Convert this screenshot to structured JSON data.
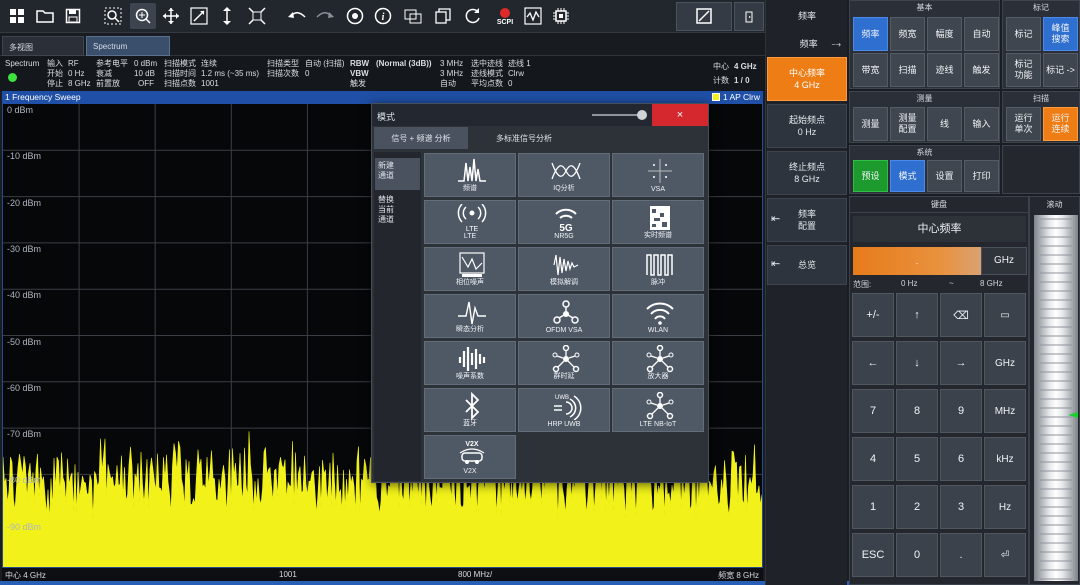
{
  "toolbar": {
    "icons": [
      "windows-icon",
      "open-folder-icon",
      "save-icon",
      "zoom-area-icon",
      "zoom-icon",
      "move-icon",
      "resize-icon",
      "vertical-arrow-icon",
      "fit-icon",
      "undo-icon",
      "redo-icon",
      "capture-icon",
      "info-icon",
      "screenshot-icon",
      "copy-icon",
      "refresh-icon",
      "scpi-icon",
      "waveform-icon",
      "chip-icon"
    ],
    "scpi_label": "SCPI"
  },
  "tabs": [
    "多视图",
    "Spectrum"
  ],
  "info": {
    "spectrum": "Spectrum",
    "input_label": "输入",
    "input_value": "RF",
    "start_label": "开始",
    "start_value": "0 Hz",
    "stop_label": "停止",
    "stop_value": "8 GHz",
    "ref_label": "参考电平",
    "ref_value": "0 dBm",
    "att_label": "衰减",
    "att_value": "10 dB",
    "preamp_label": "前置放",
    "preamp_value": "OFF",
    "sweepmode_label": "扫描模式",
    "sweepmode_value": "连续",
    "sweeptime_label": "扫描时间",
    "sweeptime_value": "1.2 ms (~35 ms)",
    "points_label": "扫描点数",
    "points_value": "1001",
    "sweeptype_label": "扫描类型",
    "sweeptype_value": "自动 (扫描)",
    "count_label": "扫描次数",
    "count_value": "0",
    "rbw_label": "RBW",
    "rbw_mode": "(Normal (3dB))",
    "rbw_value": "3 MHz",
    "vbw_label": "VBW",
    "vbw_value": "3 MHz",
    "trigger_label": "触发",
    "trigger_value": "自动",
    "sel_trace_label": "选中迹线",
    "sel_trace_value": "迹线 1",
    "trace_mode_label": "迹线模式",
    "trace_mode_value": "Clrw",
    "avg_label": "平均点数",
    "avg_value": "0",
    "center_label": "中心",
    "center_value": "4 GHz",
    "counter_label": "计数",
    "counter_value": "1 / 0"
  },
  "sweep_title": "1 Frequency Sweep",
  "trace_tag": "1 AP Clrw",
  "plot": {
    "ylabels": [
      "0 dBm",
      "-10 dBm",
      "-20 dBm",
      "-30 dBm",
      "-40 dBm",
      "-50 dBm",
      "-60 dBm",
      "-70 dBm",
      "-80 dBm",
      "-90 dBm"
    ],
    "x_left": "中心 4 GHz",
    "x_mid1": "1001",
    "x_mid2": "800 MHz/",
    "x_right": "频宽 8 GHz",
    "trace_color": "#f2f21a"
  },
  "dialog": {
    "title": "模式",
    "close": "×",
    "tabs": [
      "信号 + 频谱 分析",
      "多标准信号分析"
    ],
    "side": [
      "新建\n通道",
      "替换\n当前\n通道"
    ],
    "modes": [
      {
        "label": "频谱",
        "icon": "spectrum-icon"
      },
      {
        "label": "IQ分析",
        "icon": "iq-icon"
      },
      {
        "label": "VSA",
        "icon": "vsa-icon"
      },
      {
        "label": "LTE",
        "icon": "lte-icon"
      },
      {
        "label": "NR5G",
        "icon": "5g-icon"
      },
      {
        "label": "实时频谱",
        "icon": "realtime-icon"
      },
      {
        "label": "相位噪声",
        "icon": "phase-noise-icon"
      },
      {
        "label": "模拟解调",
        "icon": "analog-demod-icon"
      },
      {
        "label": "脉冲",
        "icon": "pulse-icon"
      },
      {
        "label": "瞬态分析",
        "icon": "transient-icon"
      },
      {
        "label": "OFDM VSA",
        "icon": "ofdm-icon"
      },
      {
        "label": "WLAN",
        "icon": "wlan-icon"
      },
      {
        "label": "噪声系数",
        "icon": "noise-figure-icon"
      },
      {
        "label": "群时延",
        "icon": "group-delay-icon"
      },
      {
        "label": "放大器",
        "icon": "amplifier-icon"
      },
      {
        "label": "蓝牙",
        "icon": "bluetooth-icon"
      },
      {
        "label": "HRP UWB",
        "icon": "uwb-icon"
      },
      {
        "label": "LTE NB-IoT",
        "icon": "nbiot-icon"
      },
      {
        "label": "V2X",
        "icon": "v2x-icon"
      }
    ],
    "lte_glyph": "LTE",
    "fiveg_glyph": "5G",
    "uwb_glyph": "UWB",
    "v2x_glyph": "V2X"
  },
  "softkeys": {
    "header_label": "频率",
    "sub_label": "频率",
    "center": "中心频率",
    "center_value": "4 GHz",
    "start": "起始频点",
    "start_value": "0 Hz",
    "stop": "终止频点",
    "stop_value": "8 GHz",
    "config": "频率\n配置",
    "overview": "总览"
  },
  "groups": {
    "basic": {
      "title": "基本",
      "keys": [
        "频率",
        "频宽",
        "幅度",
        "自动",
        "带宽",
        "扫描",
        "迹线",
        "触发"
      ]
    },
    "marker": {
      "title": "标记",
      "keys": [
        "标记",
        "峰值\n搜索",
        "标记\n功能",
        "标记 ->"
      ]
    },
    "measure": {
      "title": "测量",
      "keys": [
        "测量",
        "测量\n配置",
        "线",
        "输入"
      ]
    },
    "sweep": {
      "title": "扫描",
      "keys": [
        "运行\n单次",
        "运行\n连续"
      ]
    },
    "system": {
      "title": "系统",
      "keys": [
        "预设",
        "模式",
        "设置",
        "打印"
      ]
    }
  },
  "keyboard": {
    "title": "键盘",
    "field": "中心频率",
    "bar_value": ".",
    "unit": "GHz",
    "range_label": "范围:",
    "range_min": "0 Hz",
    "range_sep": "~",
    "range_max": "8 GHz",
    "keys": [
      "+/-",
      "↑",
      "⌫",
      "▭",
      "←",
      "↓",
      "→",
      "GHz",
      "7",
      "8",
      "9",
      "MHz",
      "4",
      "5",
      "6",
      "kHz",
      "1",
      "2",
      "3",
      "Hz",
      "ESC",
      "0",
      ".",
      "⏎"
    ]
  },
  "scroll": {
    "title": "滚动"
  }
}
